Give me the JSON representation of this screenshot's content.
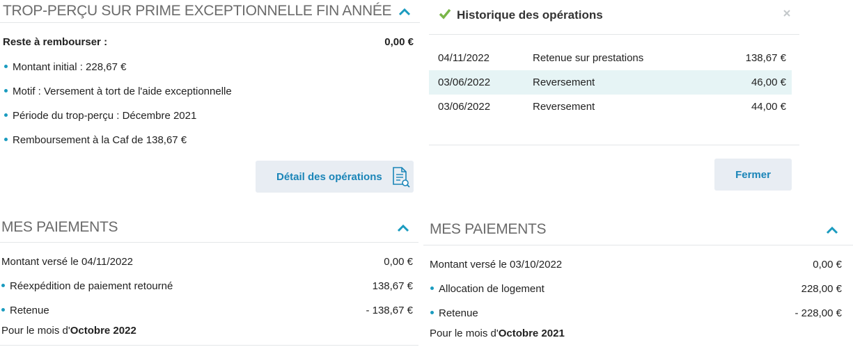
{
  "trop_percu": {
    "title": "TROP-PERÇU SUR PRIME EXCEPTIONNELLE FIN ANNÉE",
    "reste_label": "Reste à rembourser :",
    "reste_value": "0,00 €",
    "items": [
      "Montant initial : 228,67 €",
      "Motif : Versement à tort de l'aide exceptionnelle",
      "Période du trop-perçu : Décembre 2021",
      "Remboursement à la Caf de 138,67 €"
    ],
    "detail_button": "Détail des opérations"
  },
  "historique": {
    "title": "Historique des opérations",
    "rows": [
      {
        "date": "04/11/2022",
        "label": "Retenue sur prestations",
        "amount": "138,67 €"
      },
      {
        "date": "03/06/2022",
        "label": "Reversement",
        "amount": "46,00 €"
      },
      {
        "date": "03/06/2022",
        "label": "Reversement",
        "amount": "44,00 €"
      }
    ],
    "close_button": "Fermer"
  },
  "paiements_left": {
    "title": "MES PAIEMENTS",
    "montant_label": "Montant versé le 04/11/2022",
    "montant_value": "0,00 €",
    "lines": [
      {
        "label": "Réexpédition de paiement retourné",
        "value": "138,67 €"
      },
      {
        "label": "Retenue",
        "value": "- 138,67 €"
      }
    ],
    "mois_prefix": "Pour le mois d'",
    "mois_value": "Octobre 2022"
  },
  "paiements_right": {
    "title": "MES PAIEMENTS",
    "montant_label": "Montant versé le 03/10/2022",
    "montant_value": "0,00 €",
    "lines": [
      {
        "label": "Allocation de logement",
        "value": "228,00 €"
      },
      {
        "label": "Retenue",
        "value": "- 228,00 €"
      }
    ],
    "mois_prefix": "Pour le mois d'",
    "mois_value": "Octobre 2021"
  },
  "colors": {
    "accent": "#1a9bbf",
    "check": "#7ab648",
    "button_bg": "#e8edf3",
    "row_highlight": "#e6f4f5"
  }
}
